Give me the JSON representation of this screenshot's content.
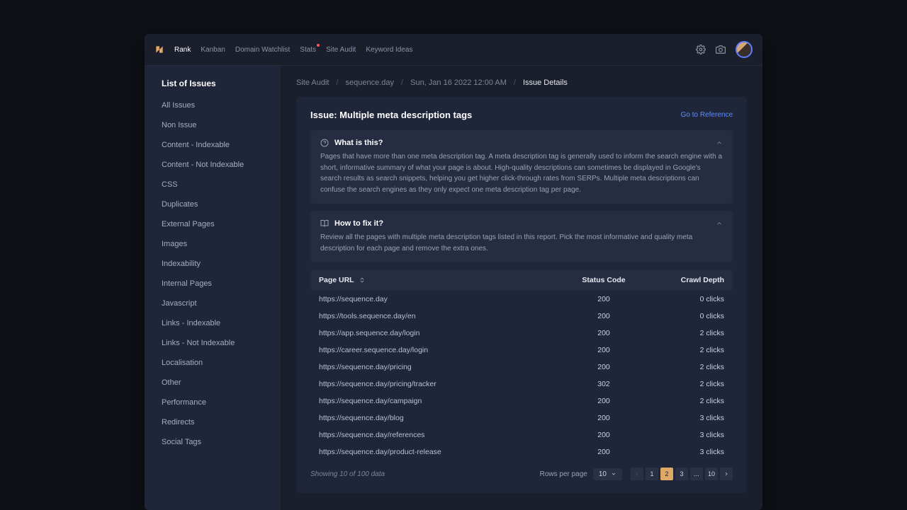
{
  "nav": {
    "items": [
      "Rank",
      "Kanban",
      "Domain Watchlist",
      "Stats",
      "Site Audit",
      "Keyword Ideas"
    ],
    "active": 0,
    "stats_dot_index": 3
  },
  "sidebar": {
    "title": "List of Issues",
    "items": [
      "All Issues",
      "Non Issue",
      "Content - Indexable",
      "Content - Not Indexable",
      "CSS",
      "Duplicates",
      "External Pages",
      "Images",
      "Indexability",
      "Internal Pages",
      "Javascript",
      "Links - Indexable",
      "Links - Not Indexable",
      "Localisation",
      "Other",
      "Performance",
      "Redirects",
      "Social Tags"
    ]
  },
  "breadcrumbs": [
    "Site Audit",
    "sequence.day",
    "Sun, Jan 16 2022 12:00 AM",
    "Issue Details"
  ],
  "issue": {
    "title": "Issue: Multiple meta description tags",
    "ref_label": "Go to Reference"
  },
  "info": {
    "what_title": "What is this?",
    "what_body": "Pages that have more than one meta description tag. A meta description tag is generally used to inform the search engine with a short, informative summary of what your page is about. High-quality descriptions can sometimes be displayed in Google's search results as search snippets, helping you get higher click-through rates from SERPs. Multiple meta descriptions can confuse the search engines as they only expect one meta description tag per page.",
    "fix_title": "How to fix it?",
    "fix_body": "Review all the pages with multiple meta description tags listed in this report. Pick the most informative and quality meta description for each page and remove the extra ones."
  },
  "table": {
    "cols": {
      "url": "Page URL",
      "status": "Status Code",
      "depth": "Crawl Depth"
    },
    "rows": [
      {
        "url": "https://sequence.day",
        "status": "200",
        "depth": "0 clicks"
      },
      {
        "url": "https://tools.sequence.day/en",
        "status": "200",
        "depth": "0 clicks"
      },
      {
        "url": "https://app.sequence.day/login",
        "status": "200",
        "depth": "2 clicks"
      },
      {
        "url": "https://career.sequence.day/login",
        "status": "200",
        "depth": "2 clicks"
      },
      {
        "url": "https://sequence.day/pricing",
        "status": "200",
        "depth": "2 clicks"
      },
      {
        "url": "https://sequence.day/pricing/tracker",
        "status": "302",
        "depth": "2 clicks"
      },
      {
        "url": "https://sequence.day/campaign",
        "status": "200",
        "depth": "2 clicks"
      },
      {
        "url": "https://sequence.day/blog",
        "status": "200",
        "depth": "3 clicks"
      },
      {
        "url": "https://sequence.day/references",
        "status": "200",
        "depth": "3 clicks"
      },
      {
        "url": "https://sequence.day/product-release",
        "status": "200",
        "depth": "3 clicks"
      }
    ]
  },
  "footer": {
    "showing": "Showing 10 of 100 data",
    "rpp_label": "Rows per page",
    "rpp_value": "10",
    "pages": [
      "1",
      "2",
      "3",
      "...",
      "10"
    ],
    "current": "2"
  }
}
